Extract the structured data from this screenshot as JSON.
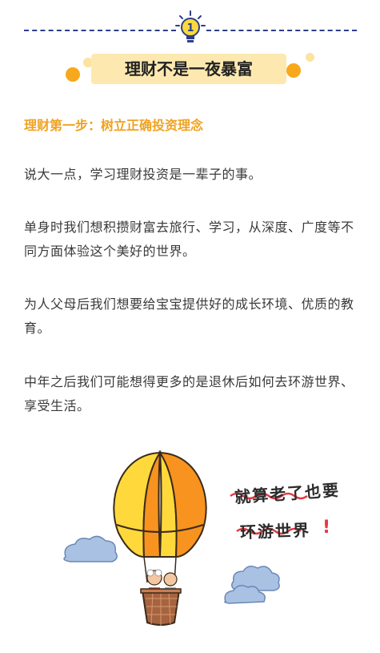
{
  "header": {
    "badge_number": "1",
    "title": "理财不是一夜暴富"
  },
  "section": {
    "heading": "理财第一步：树立正确投资理念"
  },
  "paragraphs": [
    "说大一点，学习理财投资是一辈子的事。",
    "单身时我们想积攒财富去旅行、学习，从深度、广度等不同方面体验这个美好的世界。",
    "为人父母后我们想要给宝宝提供好的成长环境、优质的教育。",
    "中年之后我们可能想得更多的是退休后如何去环游世界、享受生活。"
  ],
  "illustration": {
    "caption_line1": "就算老了也要",
    "caption_line2": "环游世界",
    "caption_mark": "!"
  },
  "colors": {
    "accent_orange": "#f0a21f",
    "banner_yellow": "#fde9b0",
    "divider_blue": "#2d3e8a",
    "balloon_orange": "#f7931e",
    "balloon_yellow": "#ffd93b",
    "wave_red": "#e8373f"
  }
}
